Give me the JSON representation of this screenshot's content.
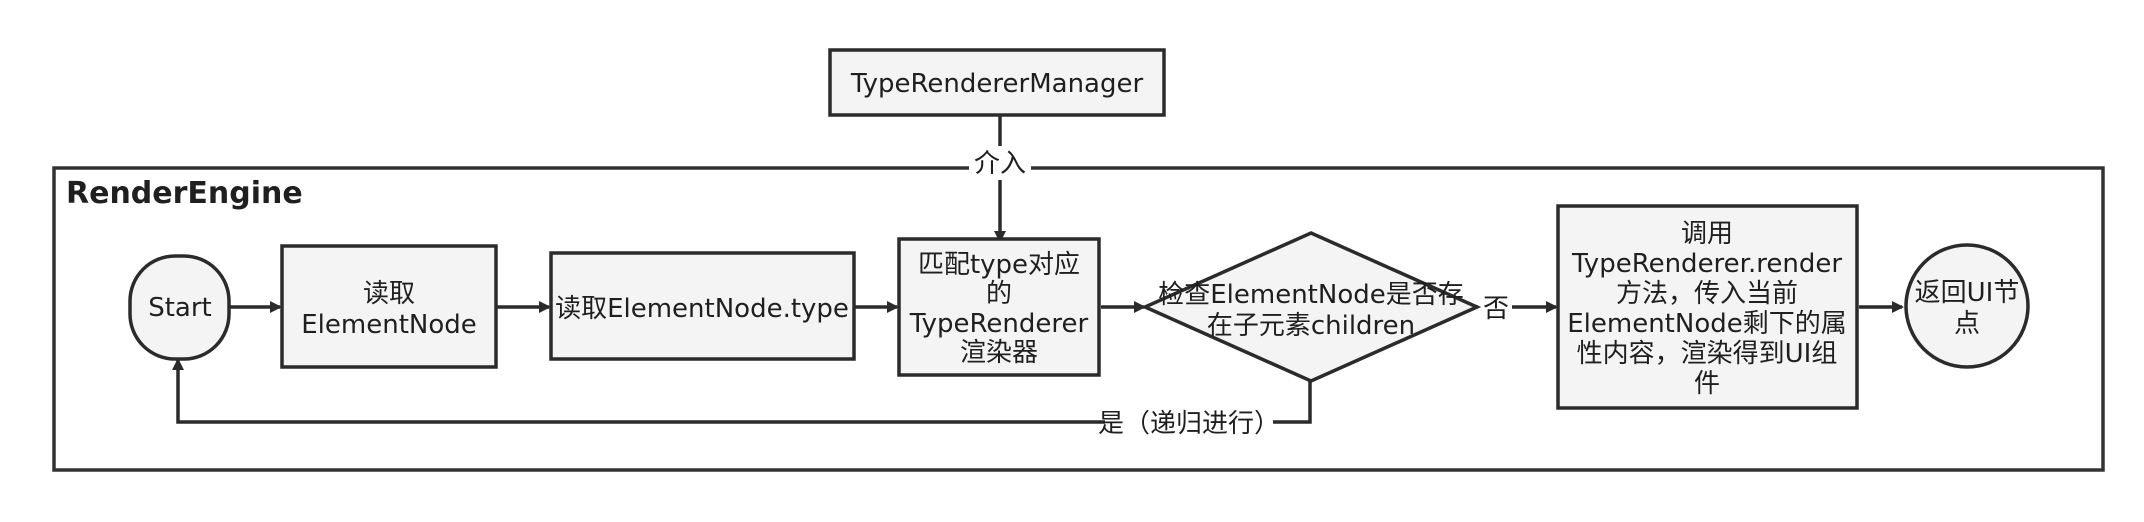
{
  "diagram": {
    "container_title": "RenderEngine",
    "nodes": {
      "manager": "TypeRendererManager",
      "start": "Start",
      "read_element": [
        "读取",
        "ElementNode"
      ],
      "read_type": "读取ElementNode.type",
      "match_renderer": [
        "匹配type对应",
        "的",
        "TypeRenderer",
        "渲染器"
      ],
      "check_children": [
        "检查ElementNode是否存",
        "在子元素children"
      ],
      "call_render": [
        "调用",
        "TypeRenderer.render",
        "方法，传入当前",
        "ElementNode剩下的属",
        "性内容，渲染得到UI组",
        "件"
      ],
      "return_ui": [
        "返回UI节",
        "点"
      ]
    },
    "edge_labels": {
      "intervene": "介入",
      "no": "否",
      "yes_recursive": "是（递归进行）"
    }
  }
}
